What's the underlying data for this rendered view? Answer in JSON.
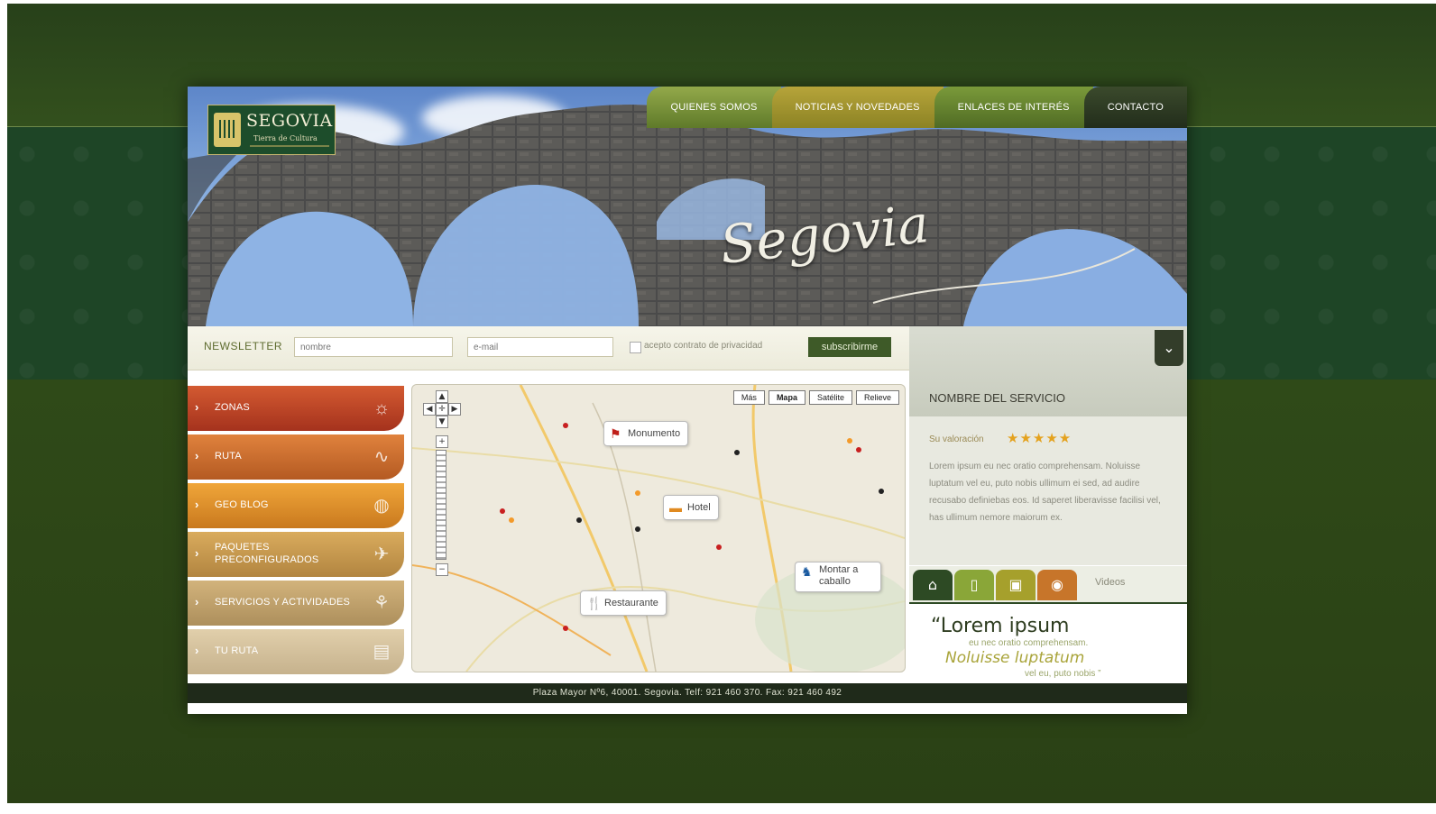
{
  "header": {
    "logo": {
      "title": "SEGOVIA",
      "subtitle": "Tierra de Cultura"
    },
    "script_title": "Segovia",
    "nav": [
      {
        "label": "QUIENES SOMOS"
      },
      {
        "label": "NOTICIAS Y NOVEDADES"
      },
      {
        "label": "ENLACES DE INTERÉS"
      },
      {
        "label": "CONTACTO"
      }
    ]
  },
  "newsletter": {
    "label": "NEWSLETTER",
    "name_placeholder": "nombre",
    "email_placeholder": "e-mail",
    "privacy_label": "acepto contrato de privacidad",
    "subscribe_label": "subscribirme"
  },
  "sidebar": {
    "items": [
      {
        "label": "ZONAS",
        "icon": "sun-icon"
      },
      {
        "label": "RUTA",
        "icon": "route-icon"
      },
      {
        "label": "GEO BLOG",
        "icon": "globe-icon"
      },
      {
        "label": "PAQUETES\nPRECONFIGURADOS",
        "icon": "plane-icon"
      },
      {
        "label": "SERVICIOS Y ACTIVIDADES",
        "icon": "activity-icon"
      },
      {
        "label": "TU RUTA",
        "icon": "map-icon"
      }
    ]
  },
  "map": {
    "types": [
      "Mapa",
      "Satélite",
      "Relieve"
    ],
    "more_label": "Más",
    "pins": {
      "monumento": "Monumento",
      "hotel": "Hotel",
      "restaurante": "Restaurante",
      "montar": "Montar a caballo"
    }
  },
  "service": {
    "title": "NOMBRE DEL SERVICIO",
    "rating_label": "Su valoración",
    "stars": "★★★★★",
    "description": "Lorem ipsum eu nec oratio comprehensam. Noluisse luptatum vel eu, puto nobis ullimum ei sed, ad audire recusabo definiebas eos. Id saperet liberavisse facilisi vel, has ullimum nemore maiorum ex.",
    "tabs_label": "Videos"
  },
  "quote": {
    "line1": "“Lorem ipsum",
    "line2": "eu nec oratio comprehensam.",
    "line3": "Noluisse luptatum",
    "line4": "vel eu, puto nobis ”"
  },
  "footer": {
    "text": "Plaza Mayor Nº6, 40001.  Segovia.  Telf: 921 460 370.  Fax: 921 460 492"
  },
  "colors": {
    "background_green": "#1e4526",
    "footer_dark": "#1f2a1a",
    "accent_orange": "#e0823d",
    "star_gold": "#e4a21e"
  }
}
